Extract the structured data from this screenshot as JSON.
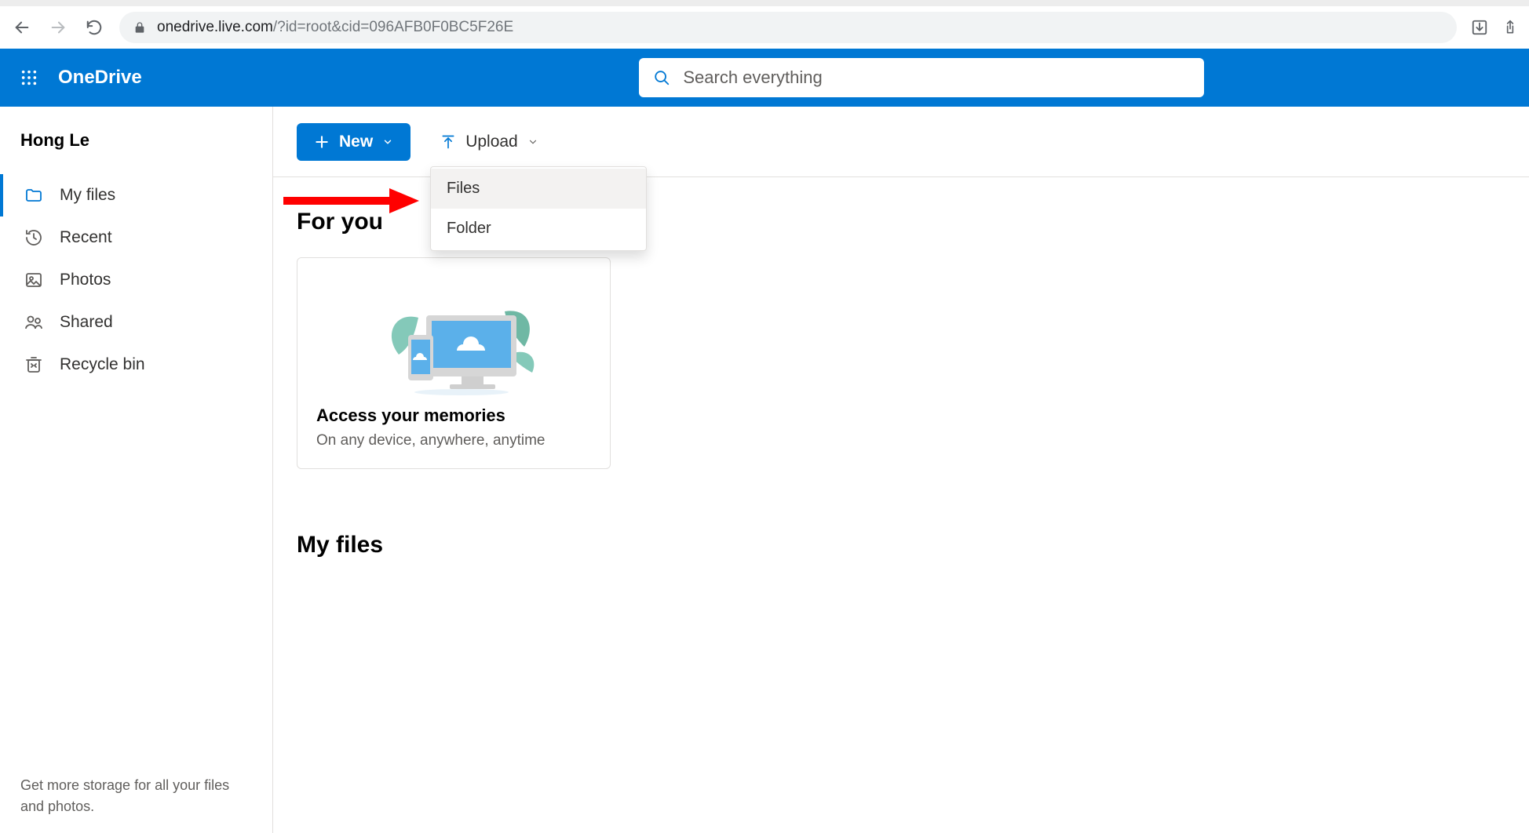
{
  "browser": {
    "url_host": "onedrive.live.com",
    "url_path": "/?id=root&cid=096AFB0F0BC5F26E"
  },
  "header": {
    "app_name": "OneDrive",
    "search_placeholder": "Search everything"
  },
  "sidebar": {
    "username": "Hong Le",
    "items": [
      {
        "label": "My files",
        "icon": "folder-icon",
        "active": true
      },
      {
        "label": "Recent",
        "icon": "recent-icon",
        "active": false
      },
      {
        "label": "Photos",
        "icon": "photos-icon",
        "active": false
      },
      {
        "label": "Shared",
        "icon": "shared-icon",
        "active": false
      },
      {
        "label": "Recycle bin",
        "icon": "recycle-icon",
        "active": false
      }
    ],
    "footer": "Get more storage for all your files and photos."
  },
  "toolbar": {
    "new_label": "New",
    "upload_label": "Upload"
  },
  "upload_menu": {
    "items": [
      {
        "label": "Files",
        "hover": true
      },
      {
        "label": "Folder",
        "hover": false
      }
    ]
  },
  "content": {
    "for_you_title": "For you",
    "card": {
      "title": "Access your memories",
      "sub": "On any device, anywhere, anytime"
    },
    "my_files_title": "My files"
  }
}
